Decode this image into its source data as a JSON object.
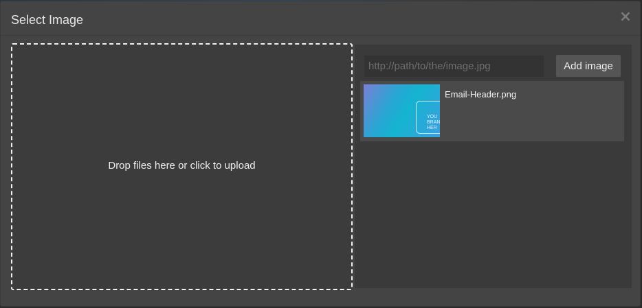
{
  "modal": {
    "title": "Select Image",
    "close_symbol": "×",
    "close_icon": "close-icon"
  },
  "dropzone": {
    "text": "Drop files here or click to upload"
  },
  "url_input": {
    "placeholder": "http://path/to/the/image.jpg",
    "value": ""
  },
  "add_button": {
    "label": "Add image"
  },
  "assets": [
    {
      "name": "Email-Header.png",
      "thumb_text": "YOU\nBRAN\nHER"
    }
  ],
  "colors": {
    "background": "#444444",
    "dropzone_border": "#f2f2f2",
    "panel": "#3a3a3a",
    "button": "#555555"
  }
}
